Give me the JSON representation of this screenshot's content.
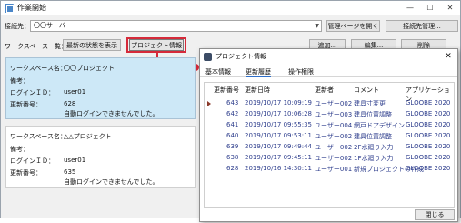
{
  "window": {
    "title": "作業開始",
    "minimize": "—",
    "maximize": "☐",
    "close": "✕"
  },
  "connection": {
    "label": "接続先：",
    "value": "〇〇サーバー",
    "open_admin_label": "管理ページを開く",
    "manage_label": "接続先管理..."
  },
  "workspace_list": {
    "label": "ワークスペース一覧：",
    "show_latest_label": "最新の状態を表示",
    "project_info_label": "プロジェクト情報",
    "add_label": "追加...",
    "edit_label": "編集...",
    "delete_label": "削除",
    "items": [
      {
        "name_label": "ワークスペース名：",
        "name": "〇〇プロジェクト",
        "note_label": "備考：",
        "note": "",
        "login_label": "ログインＩＤ：",
        "login": "user01",
        "update_label": "更新番号：",
        "update": "628",
        "message": "自動ログインできませんでした。"
      },
      {
        "name_label": "ワークスペース名：",
        "name": "△△プロジェクト",
        "note_label": "備考：",
        "note": "",
        "login_label": "ログインＩＤ：",
        "login": "user01",
        "update_label": "更新番号：",
        "update": "635",
        "message": "自動ログインできませんでした。"
      }
    ]
  },
  "dialog": {
    "title": "プロジェクト情報",
    "close_label": "✕",
    "tabs": [
      "基本情報",
      "更新履歴",
      "操作権限"
    ],
    "active_tab": "更新履歴",
    "columns": [
      "更新番号",
      "更新日時",
      "更新者",
      "コメント",
      "アプリケーション"
    ],
    "rows": [
      [
        "643",
        "2019/10/17 10:09:19",
        "ユーザー002",
        "建具寸変更",
        "GLOOBE 2020"
      ],
      [
        "642",
        "2019/10/17 10:06:28",
        "ユーザー003",
        "建具位置調整",
        "GLOOBE 2020"
      ],
      [
        "641",
        "2019/10/17 09:55:35",
        "ユーザー004",
        "網戸ドアデザイン",
        "GLOOBE 2020"
      ],
      [
        "640",
        "2019/10/17 09:53:11",
        "ユーザー002",
        "建具位置調整",
        "GLOOBE 2020"
      ],
      [
        "639",
        "2019/10/17 09:49:44",
        "ユーザー002",
        "2F水廻り入力",
        "GLOOBE 2020"
      ],
      [
        "638",
        "2019/10/17 09:45:11",
        "ユーザー002",
        "1F水廻り入力",
        "GLOOBE 2020"
      ],
      [
        "628",
        "2019/10/16 14:30:11",
        "ユーザー001",
        "新規プロジェクトの作成",
        "GLOOBE 2020"
      ]
    ],
    "footer_close_label": "閉じる"
  },
  "colors": {
    "accent": "#2f6fc9",
    "callout": "#d52a3a",
    "selected_card": "#cde8f7"
  }
}
